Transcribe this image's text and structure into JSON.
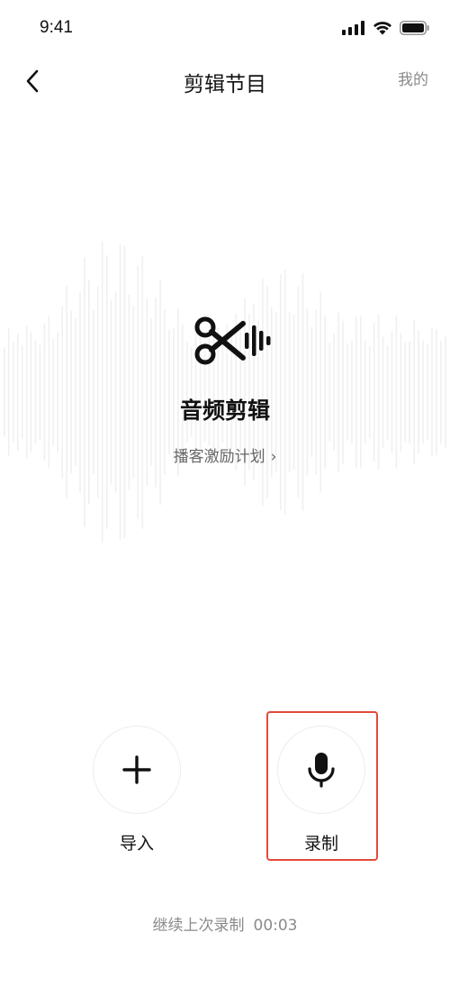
{
  "status_bar": {
    "time": "9:41",
    "icons": [
      "signal-icon",
      "wifi-icon",
      "battery-icon"
    ]
  },
  "nav": {
    "back_icon": "chevron-left-icon",
    "title": "剪辑节目",
    "right_label": "我的"
  },
  "hero": {
    "icon": "scissors-waveform-icon",
    "title": "音频剪辑",
    "link_label": "播客激励计划",
    "link_chevron": "›"
  },
  "actions": {
    "import": {
      "icon": "plus-icon",
      "label": "导入"
    },
    "record": {
      "icon": "microphone-icon",
      "label": "录制"
    }
  },
  "continue": {
    "label": "继续上次录制",
    "time": "00:03"
  },
  "colors": {
    "highlight": "#e24a3b",
    "muted_text": "#8a8a8a",
    "waveform": "#f0f0f0"
  }
}
